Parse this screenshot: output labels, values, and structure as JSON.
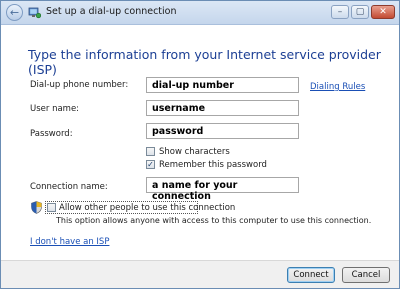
{
  "window": {
    "title": "Set up a dial-up connection",
    "controls": {
      "minimize": "–",
      "maximize": "▢",
      "close": "✕"
    },
    "back_glyph": "←"
  },
  "content": {
    "heading": "Type the information from your Internet service provider (ISP)",
    "phone": {
      "label": "Dial-up phone number:",
      "value": "dial-up number"
    },
    "dialing_rules": "Dialing Rules",
    "username": {
      "label": "User name:",
      "value": "username"
    },
    "password": {
      "label": "Password:",
      "value": "password"
    },
    "show_characters": {
      "label": "Show characters",
      "checked": false
    },
    "remember_password": {
      "label": "Remember this password",
      "checked": true,
      "mark": "✓"
    },
    "connection_name": {
      "label": "Connection name:",
      "value": "a name for your connection"
    },
    "allow_others": {
      "label": "Allow other people to use this connection",
      "checked": false
    },
    "allow_note": "This option allows anyone with access to this computer to use this connection.",
    "no_isp": "I don't have an ISP"
  },
  "footer": {
    "connect": "Connect",
    "cancel": "Cancel"
  },
  "icons": {
    "title": "network-wizard-icon",
    "shield": "uac-shield-icon"
  },
  "colors": {
    "heading": "#1c3f94",
    "link": "#1a4fb5",
    "titlebar": "#c5d6ec"
  }
}
